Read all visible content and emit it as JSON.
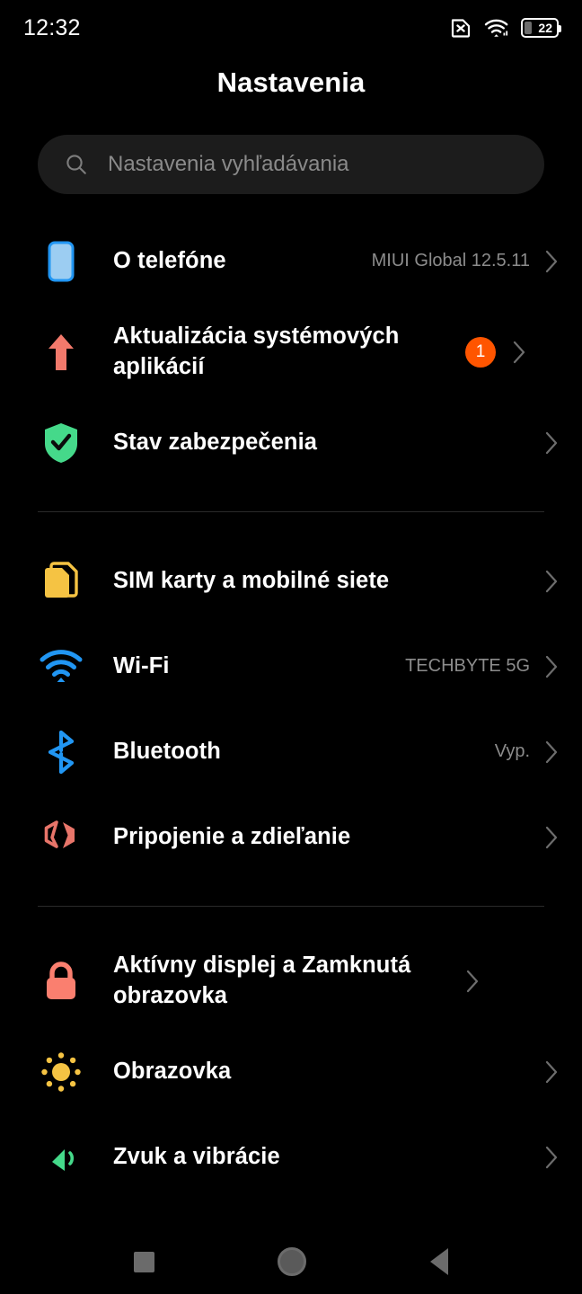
{
  "status_bar": {
    "clock": "12:32",
    "icons": [
      "no-sim-icon",
      "wifi-icon",
      "battery-icon"
    ],
    "battery_level": "22"
  },
  "header": {
    "title": "Nastavenia"
  },
  "search": {
    "placeholder": "Nastavenia vyhľadávania",
    "icon": "search-icon",
    "value": ""
  },
  "colors": {
    "background": "#000000",
    "search_bg": "#1c1c1c",
    "divider": "#2a2a2a",
    "badge": "#ff5500",
    "value_text": "#8c8c8c",
    "phone_icon": "#9ccdf2",
    "phone_icon_border": "#2196f3",
    "update_icon": "#f2796b",
    "shield_icon": "#45d98a",
    "sim_icon": "#f5c343",
    "wifi_icon": "#2196f3",
    "bluetooth_icon": "#2196f3",
    "sharing_icon": "#e8756a",
    "lock_icon": "#fa7f6f",
    "sun_icon": "#f5c343",
    "sound_icon": "#45d98a"
  },
  "groups": [
    {
      "id": "device-group",
      "items": [
        {
          "name": "about-phone",
          "label": "O telefóne",
          "value": "MIUI Global 12.5.11",
          "icon": "phone-icon",
          "badge": "",
          "chevron": true
        },
        {
          "name": "system-app-updater",
          "label": "Aktualizácia systémových aplikácií",
          "value": "",
          "icon": "up-arrow-icon",
          "badge": "1",
          "chevron": true
        },
        {
          "name": "security-status",
          "label": "Stav zabezpečenia",
          "value": "",
          "icon": "shield-check-icon",
          "badge": "",
          "chevron": true
        }
      ]
    },
    {
      "id": "connectivity-group",
      "items": [
        {
          "name": "sim-cards-mobile-networks",
          "label": "SIM karty a mobilné siete",
          "value": "",
          "icon": "sim-card-icon",
          "badge": "",
          "chevron": true
        },
        {
          "name": "wifi",
          "label": "Wi-Fi",
          "value": "TECHBYTE 5G",
          "icon": "wifi-icon",
          "badge": "",
          "chevron": true
        },
        {
          "name": "bluetooth",
          "label": "Bluetooth",
          "value": "Vyp.",
          "icon": "bluetooth-icon",
          "badge": "",
          "chevron": true
        },
        {
          "name": "connection-and-sharing",
          "label": "Pripojenie a zdieľanie",
          "value": "",
          "icon": "sharing-icon",
          "badge": "",
          "chevron": true
        }
      ]
    },
    {
      "id": "display-group",
      "items": [
        {
          "name": "always-on-display-lock-screen",
          "label": "Aktívny displej a Zamknutá obrazovka",
          "value": "",
          "icon": "lock-icon",
          "badge": "",
          "chevron": true
        },
        {
          "name": "display",
          "label": "Obrazovka",
          "value": "",
          "icon": "sun-icon",
          "badge": "",
          "chevron": true
        },
        {
          "name": "sound-and-vibration",
          "label": "Zvuk a vibrácie",
          "value": "",
          "icon": "sound-icon",
          "badge": "",
          "chevron": true
        }
      ]
    }
  ],
  "nav_bar": {
    "recents": "recents-button",
    "home": "home-button",
    "back": "back-button"
  }
}
